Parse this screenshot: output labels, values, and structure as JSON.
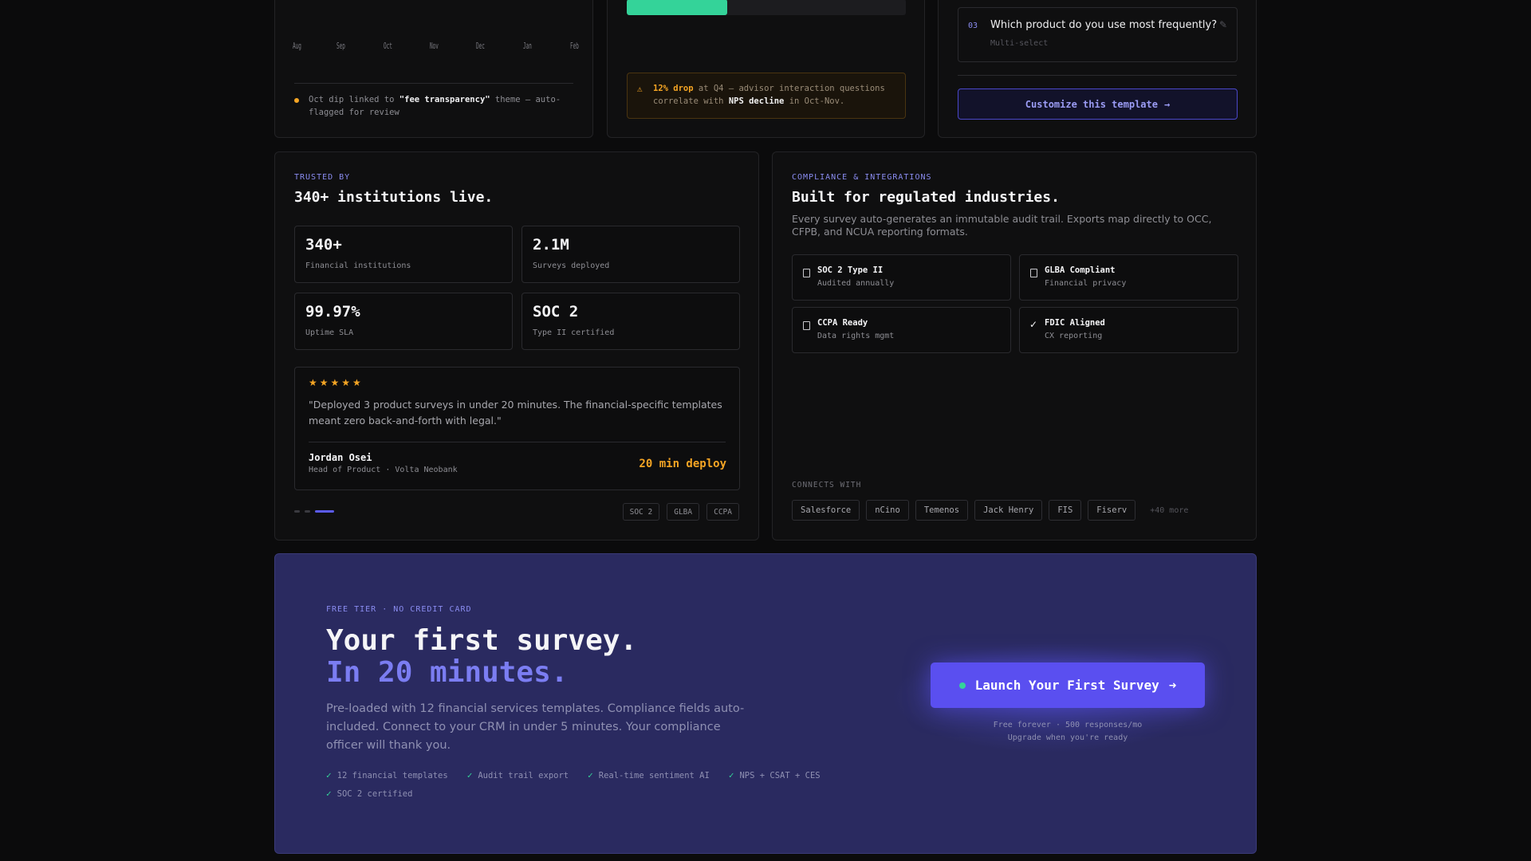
{
  "top_left": {
    "months": [
      "Aug",
      "Sep",
      "Oct",
      "Nov",
      "Dec",
      "Jan",
      "Feb"
    ],
    "note_prefix": "Oct dip linked to ",
    "note_highlight": "\"fee transparency\"",
    "note_suffix": " theme — auto-flagged for review"
  },
  "top_mid": {
    "progress_fraction": 0.36,
    "alert_highlight": "12% drop",
    "alert_part1": " at Q4 — advisor interaction questions correlate with ",
    "alert_highlight2": "NPS decline",
    "alert_part2": " in Oct-Nov."
  },
  "top_right": {
    "question_number": "03",
    "question_text": "Which product do you use most frequently?",
    "question_type": "Multi-select",
    "customize_label": "Customize this template"
  },
  "trusted": {
    "eyebrow": "TRUSTED BY",
    "title": "340+ institutions live.",
    "stats": [
      {
        "value": "340+",
        "label": "Financial institutions"
      },
      {
        "value": "2.1M",
        "label": "Surveys deployed"
      },
      {
        "value": "99.97%",
        "label": "Uptime SLA"
      },
      {
        "value": "SOC 2",
        "label": "Type II certified"
      }
    ],
    "rating_stars": 5,
    "stars_text": "★★★★★",
    "quote": "\"Deployed 3 product surveys in under 20 minutes. The financial-specific templates meant zero back-and-forth with legal.\"",
    "author": "Jordan Osei",
    "author_role": "Head of Product · Volta Neobank",
    "deploy_label": "20 min deploy",
    "badges": [
      "SOC 2",
      "GLBA",
      "CCPA"
    ]
  },
  "compliance": {
    "eyebrow": "COMPLIANCE & INTEGRATIONS",
    "title": "Built for regulated industries.",
    "description": "Every survey auto-generates an immutable audit trail. Exports map directly to OCC, CFPB, and NCUA reporting formats.",
    "certs": [
      {
        "name": "SOC 2 Type II",
        "sub": "Audited annually",
        "icon": "document-icon"
      },
      {
        "name": "GLBA Compliant",
        "sub": "Financial privacy",
        "icon": "document-icon"
      },
      {
        "name": "CCPA Ready",
        "sub": "Data rights mgmt",
        "icon": "document-icon"
      },
      {
        "name": "FDIC Aligned",
        "sub": "CX reporting",
        "icon": "check-icon"
      }
    ],
    "connects_label": "CONNECTS WITH",
    "integrations": [
      "Salesforce",
      "nCino",
      "Temenos",
      "Jack Henry",
      "FIS",
      "Fiserv"
    ],
    "more_label": "+40 more"
  },
  "cta": {
    "eyebrow": "FREE TIER · NO CREDIT CARD",
    "title_line1": "Your first survey.",
    "title_line2": "In 20 minutes.",
    "description": "Pre-loaded with 12 financial services templates. Compliance fields auto-included. Connect to your CRM in under 5 minutes. Your compliance officer will thank you.",
    "features": [
      "12 financial templates",
      "Audit trail export",
      "Real-time sentiment AI",
      "NPS + CSAT + CES",
      "SOC 2 certified"
    ],
    "button_label": "Launch Your First Survey",
    "note_line1": "Free forever · 500 responses/mo",
    "note_line2": "Upgrade when you're ready"
  },
  "colors": {
    "accent": "#5a4ff0",
    "accent_text": "#8a8cf0",
    "warning": "#f5a524",
    "success": "#34d399",
    "cta_background": "#2a2a60"
  }
}
